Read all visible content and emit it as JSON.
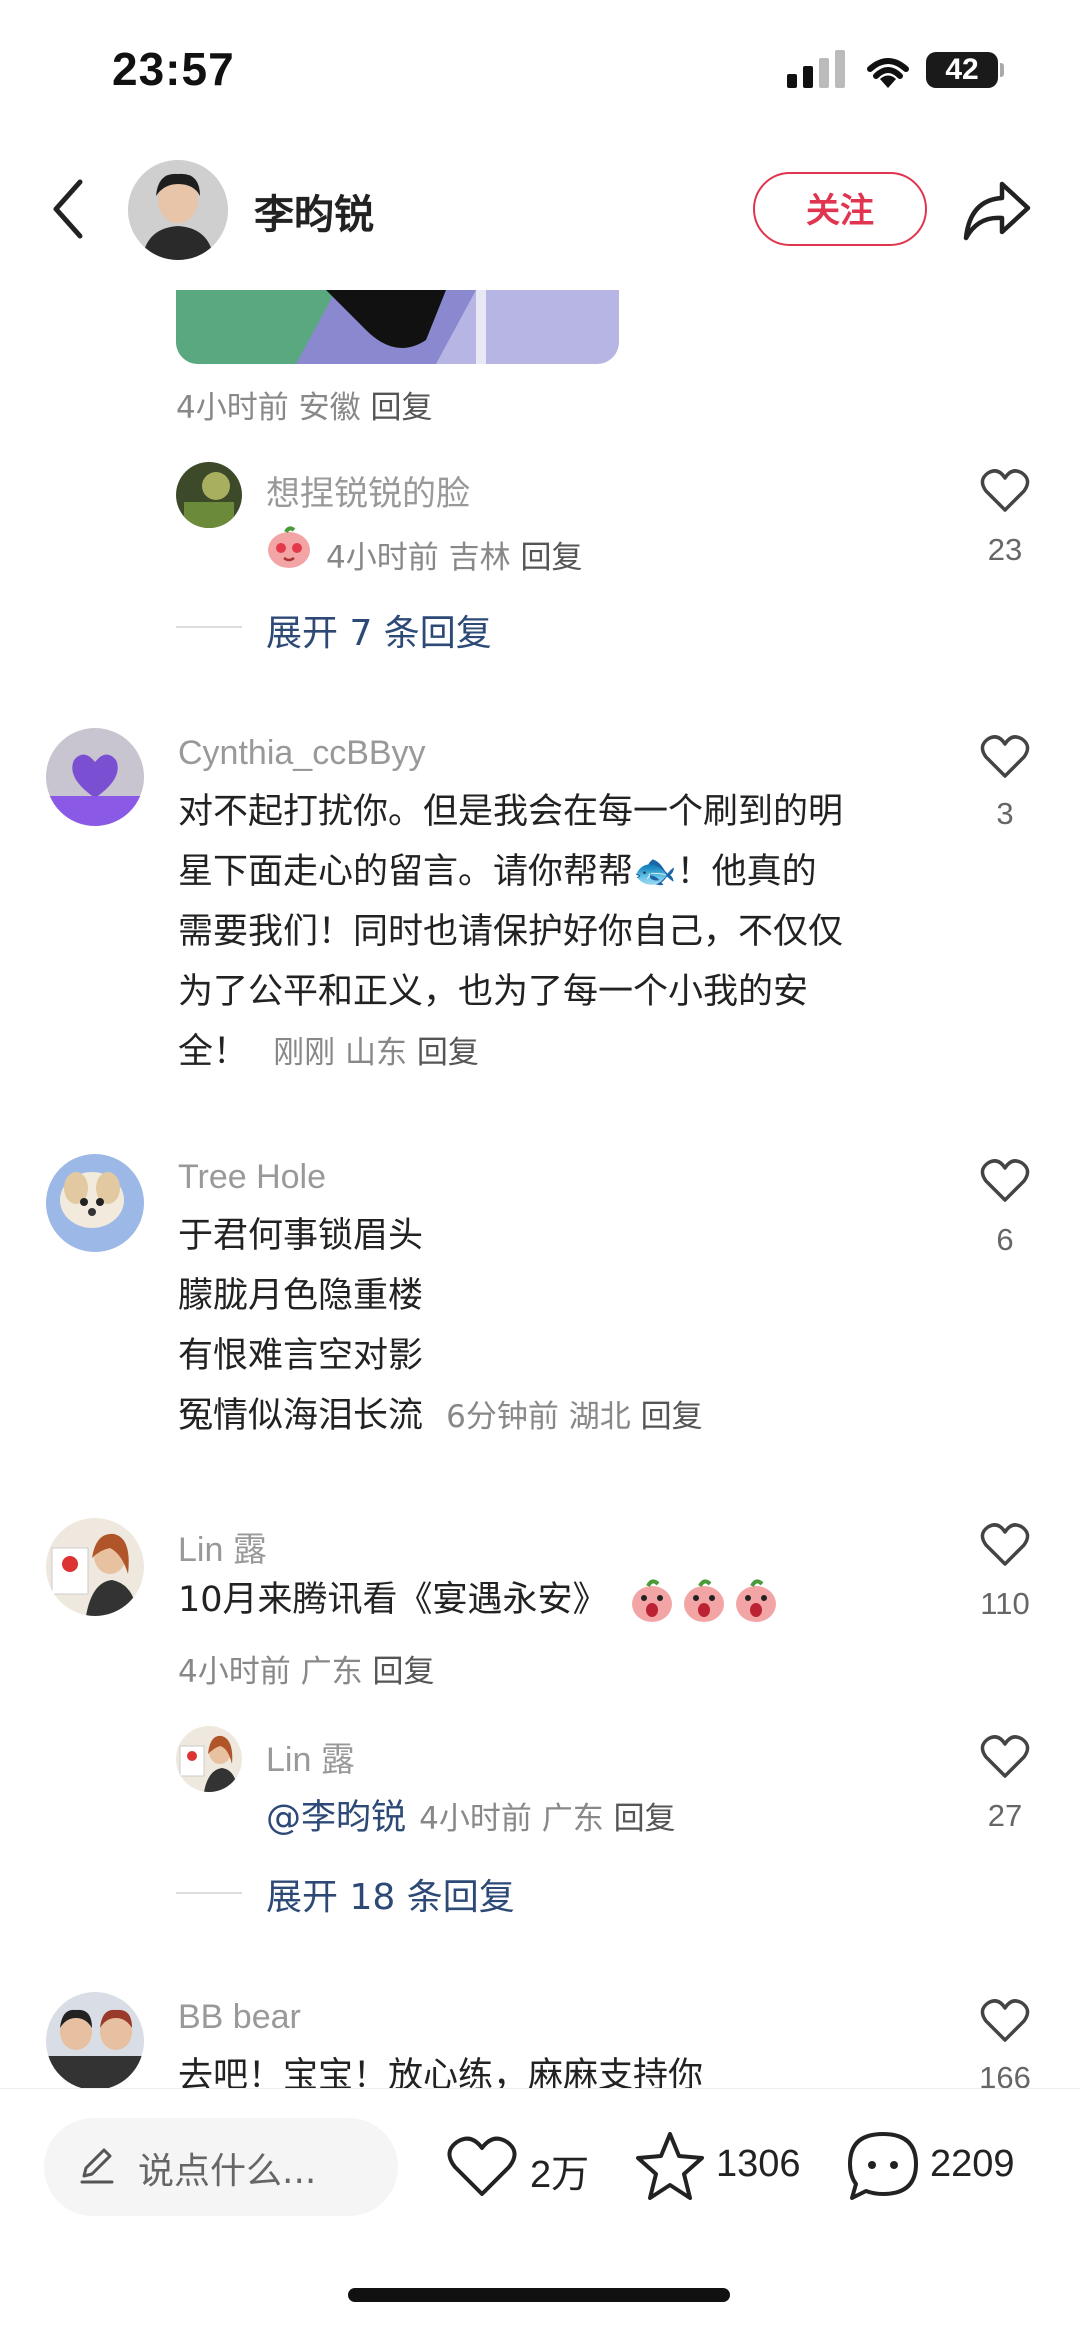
{
  "status": {
    "time": "23:57",
    "battery": "42"
  },
  "header": {
    "author": "李昀锐",
    "follow_label": "关注"
  },
  "first_comment": {
    "meta_time": "4小时前",
    "meta_region": "安徽",
    "meta_reply": "回复",
    "subreply": {
      "user": "想捏锐锐的脸",
      "meta_time": "4小时前",
      "meta_region": "吉林",
      "meta_reply": "回复",
      "likes": "23"
    },
    "expand_label": "展开 7 条回复"
  },
  "comments": [
    {
      "user": "Cynthia_ccBByy",
      "lines": [
        "对不起打扰你。但是我会在每一个刷到的明",
        "星下面走心的留言。请你帮帮🐟！他真的",
        "需要我们！同时也请保护好你自己，不仅仅",
        "为了公平和正义，也为了每一个小我的安"
      ],
      "last_line": "全！",
      "meta_time": "刚刚",
      "meta_region": "山东",
      "meta_reply": "回复",
      "likes": "3"
    },
    {
      "user": "Tree Hole",
      "lines": [
        "于君何事锁眉头",
        "朦胧月色隐重楼",
        "有恨难言空对影"
      ],
      "last_line": "冤情似海泪长流",
      "meta_time": "6分钟前",
      "meta_region": "湖北",
      "meta_reply": "回复",
      "likes": "6"
    },
    {
      "user": "Lin 露",
      "text": "10月来腾讯看《宴遇永安》",
      "meta_time": "4小时前",
      "meta_region": "广东",
      "meta_reply": "回复",
      "likes": "110",
      "subreply": {
        "user": "Lin 露",
        "mention": "@李昀锐",
        "meta_time": "4小时前",
        "meta_region": "广东",
        "meta_reply": "回复",
        "likes": "27"
      },
      "expand_label": "展开 18 条回复"
    },
    {
      "user": "BB bear",
      "text": "去吧！宝宝！放心练，麻麻支持你",
      "likes": "166"
    }
  ],
  "bottom_bar": {
    "placeholder": "说点什么...",
    "likes": "2万",
    "favorites": "1306",
    "comments": "2209"
  },
  "colors": {
    "accent": "#e0344f",
    "link": "#2d4a77"
  }
}
